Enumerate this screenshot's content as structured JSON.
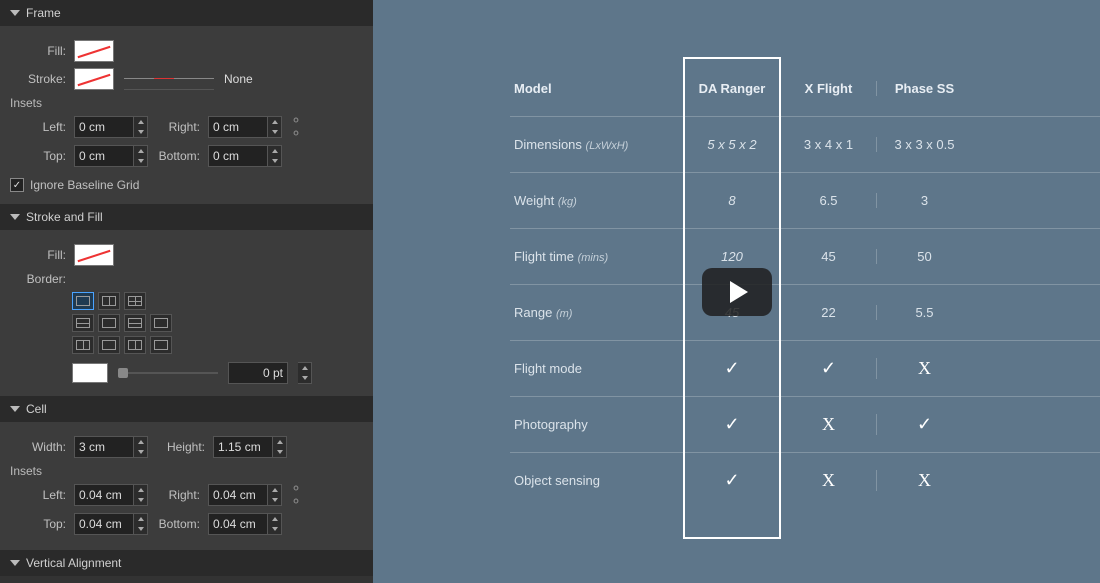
{
  "frame": {
    "title": "Frame",
    "fill_label": "Fill:",
    "stroke_label": "Stroke:",
    "stroke_style": "None",
    "insets_label": "Insets",
    "left_label": "Left:",
    "left": "0 cm",
    "right_label": "Right:",
    "right": "0 cm",
    "top_label": "Top:",
    "top": "0 cm",
    "bottom_label": "Bottom:",
    "bottom": "0 cm",
    "ignore_baseline": "Ignore Baseline Grid",
    "ignore_checked": true
  },
  "strokefill": {
    "title": "Stroke and Fill",
    "fill_label": "Fill:",
    "border_label": "Border:",
    "pt": "0 pt"
  },
  "cell": {
    "title": "Cell",
    "width_label": "Width:",
    "width": "3 cm",
    "height_label": "Height:",
    "height": "1.15 cm",
    "insets_label": "Insets",
    "left_label": "Left:",
    "left": "0.04 cm",
    "right_label": "Right:",
    "right": "0.04 cm",
    "top_label": "Top:",
    "top": "0.04 cm",
    "bottom_label": "Bottom:",
    "bottom": "0.04 cm"
  },
  "valign": {
    "title": "Vertical Alignment"
  },
  "table": {
    "h0": "Model",
    "h1": "DA Ranger",
    "h2": "X Flight",
    "h3": "Phase SS",
    "r1_l": "Dimensions",
    "r1_h": "(LxWxH)",
    "r1_1": "5 x 5 x 2",
    "r1_2": "3 x 4 x 1",
    "r1_3": "3 x 3 x 0.5",
    "r2_l": "Weight",
    "r2_h": "(kg)",
    "r2_1": "8",
    "r2_2": "6.5",
    "r2_3": "3",
    "r3_l": "Flight time",
    "r3_h": "(mins)",
    "r3_1": "120",
    "r3_2": "45",
    "r3_3": "50",
    "r4_l": "Range",
    "r4_h": "(m)",
    "r4_1": "45",
    "r4_2": "22",
    "r4_3": "5.5",
    "r5_l": "Flight mode",
    "r5_1": "✓",
    "r5_2": "✓",
    "r5_3": "X",
    "r6_l": "Photography",
    "r6_1": "✓",
    "r6_2": "X",
    "r6_3": "✓",
    "r7_l": "Object sensing",
    "r7_1": "✓",
    "r7_2": "X",
    "r7_3": "X"
  }
}
